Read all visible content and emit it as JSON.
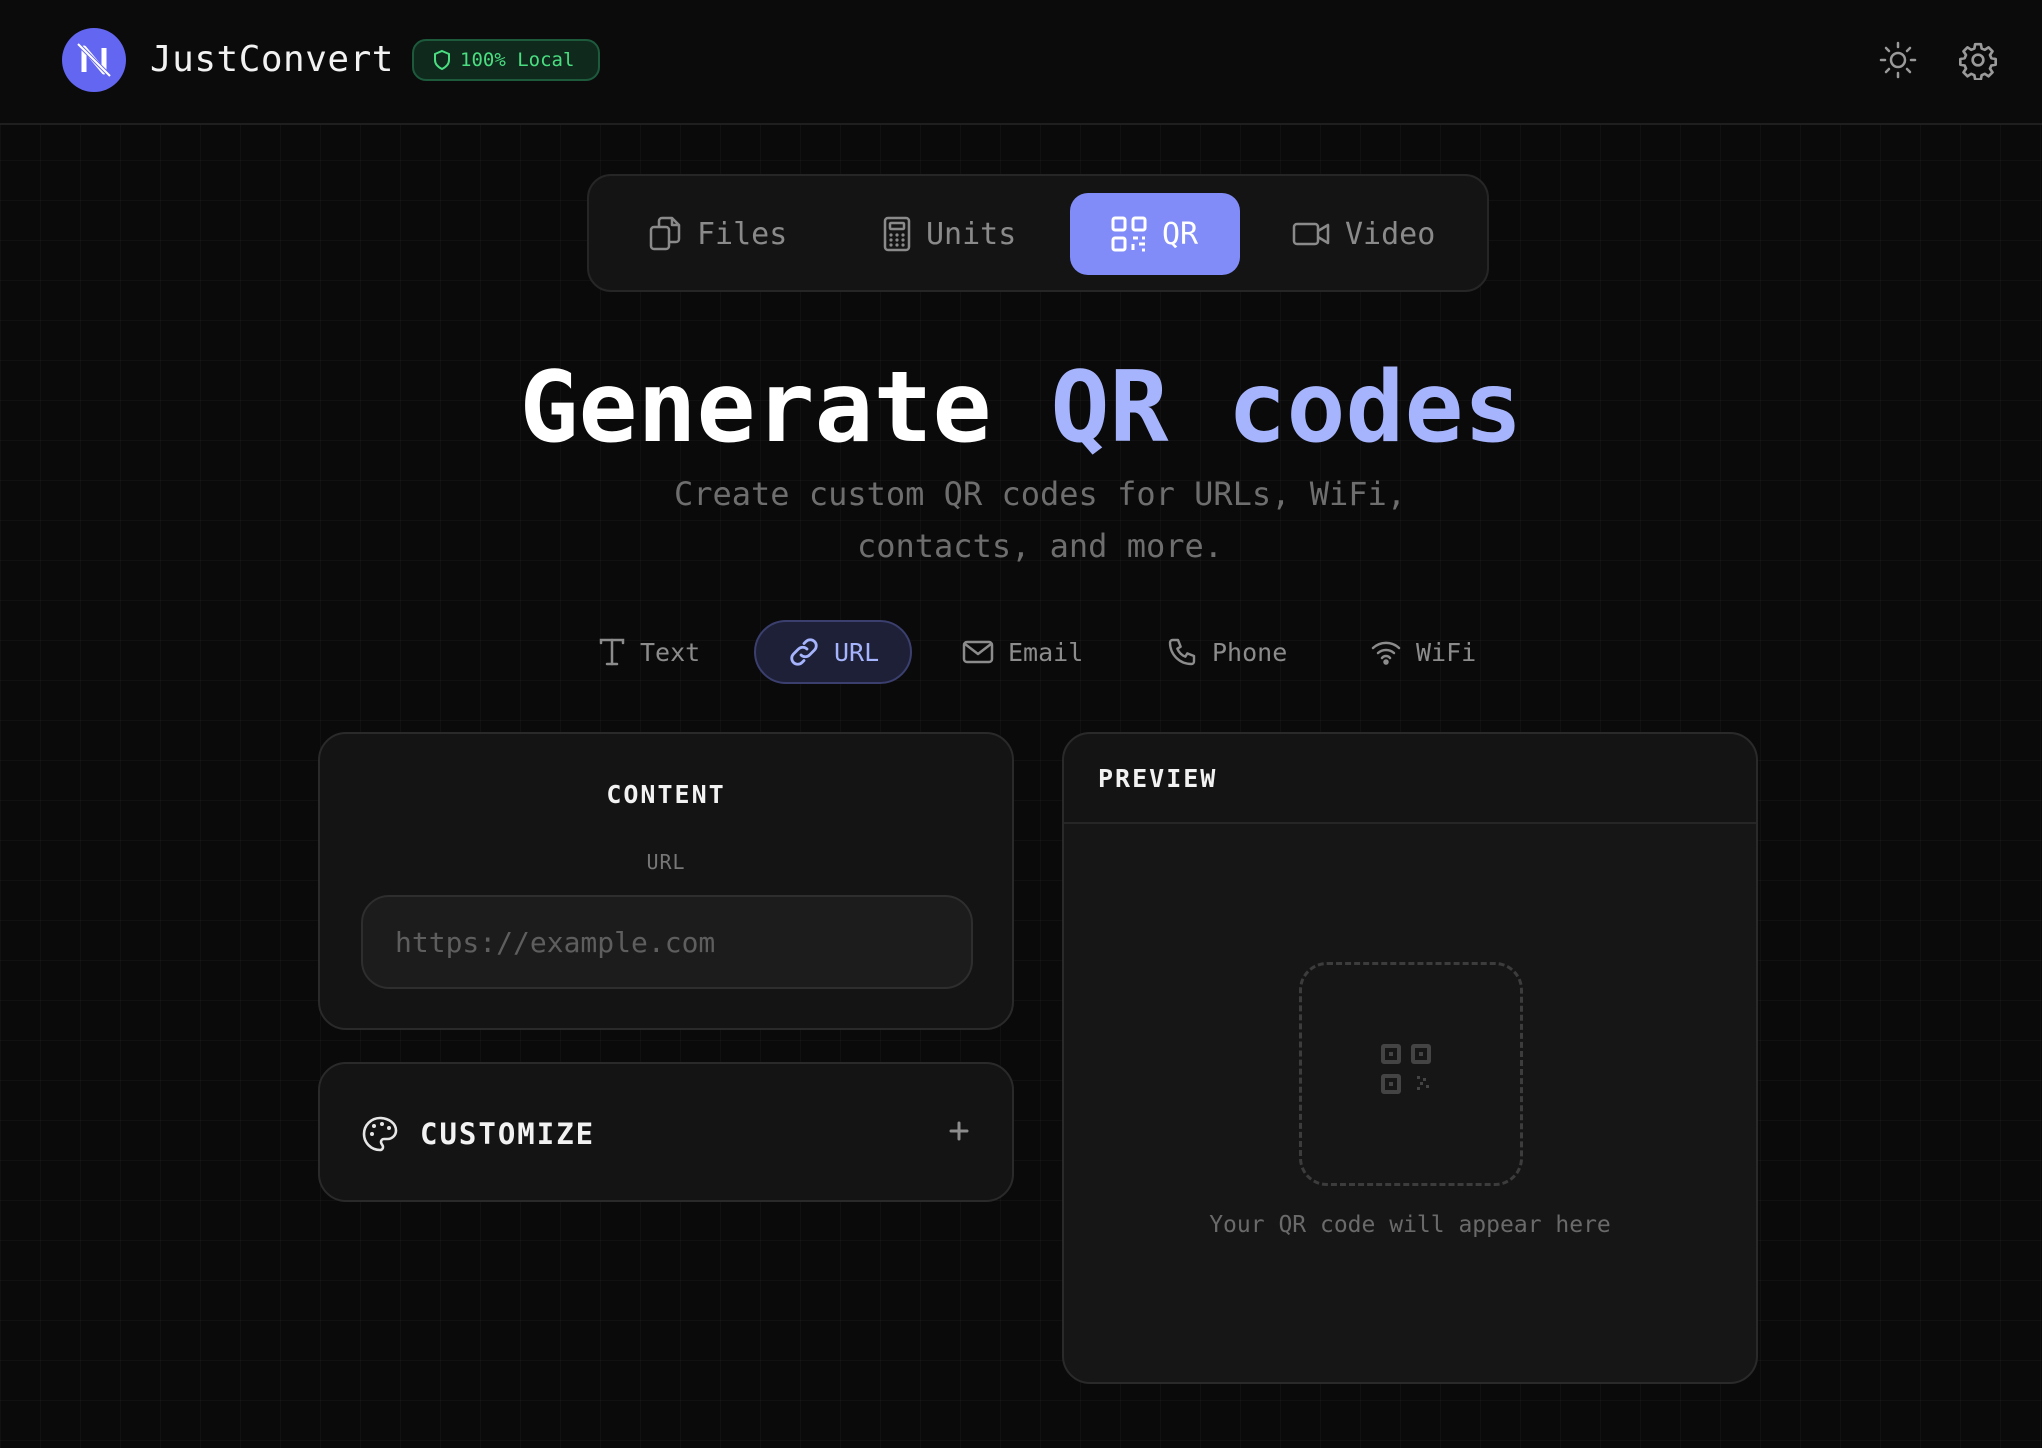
{
  "header": {
    "app_name": "JustConvert",
    "badge": "100% Local",
    "theme_icon": "sun-icon",
    "settings_icon": "gear-icon"
  },
  "tabs": [
    {
      "label": "Files",
      "icon": "files-icon",
      "active": false
    },
    {
      "label": "Units",
      "icon": "calculator-icon",
      "active": false
    },
    {
      "label": "QR",
      "icon": "qr-code-icon",
      "active": true
    },
    {
      "label": "Video",
      "icon": "video-icon",
      "active": false
    }
  ],
  "hero": {
    "title_start": "Generate",
    "title_accent": "QR codes",
    "subtitle": "Create custom QR codes for URLs, WiFi, contacts, and more."
  },
  "qr_types": [
    {
      "label": "Text",
      "icon": "text-icon",
      "active": false
    },
    {
      "label": "URL",
      "icon": "link-icon",
      "active": true
    },
    {
      "label": "Email",
      "icon": "mail-icon",
      "active": false
    },
    {
      "label": "Phone",
      "icon": "phone-icon",
      "active": false
    },
    {
      "label": "WiFi",
      "icon": "wifi-icon",
      "active": false
    }
  ],
  "content": {
    "title": "CONTENT",
    "field_label": "URL",
    "field_value": "",
    "field_placeholder": "https://example.com"
  },
  "customize": {
    "label": "CUSTOMIZE",
    "icon": "palette-icon"
  },
  "preview": {
    "title": "PREVIEW",
    "empty_message": "Your QR code will appear here"
  },
  "colors": {
    "accent": "#818cf8",
    "accent_light": "#a5b4fc",
    "logo": "#6366f1",
    "badge_green": "#4ade80",
    "background": "#0a0a0a",
    "card": "#141414"
  }
}
